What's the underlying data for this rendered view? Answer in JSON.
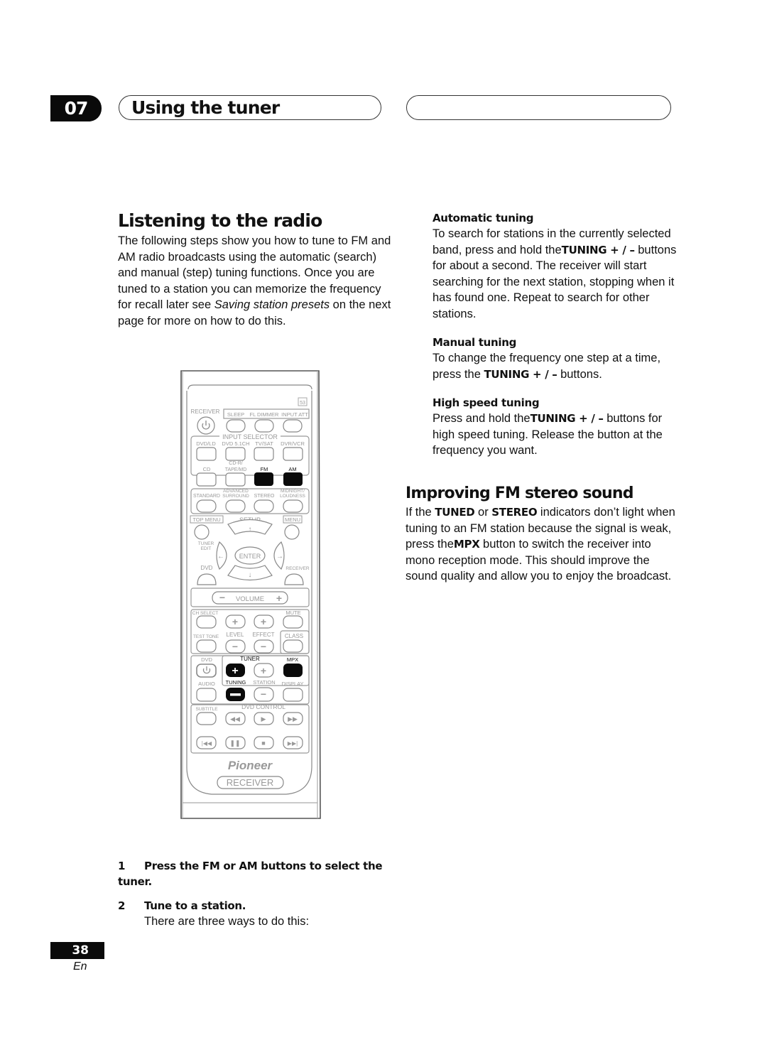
{
  "header": {
    "chapter_number": "07",
    "chapter_title": "Using the tuner"
  },
  "section1": {
    "title": "Listening to the radio",
    "intro_before": "The following steps show you how to tune to FM and AM radio broadcasts using the automatic (search) and manual (step) tuning functions. Once you are tuned to a station you can memorize the frequency for recall later see ",
    "intro_italic": "Saving station presets",
    "intro_after": " on the next page for more on how to do this."
  },
  "remote": {
    "receiver_label": "RECEIVER",
    "top_labels": [
      "SLEEP",
      "FL DIMMER",
      "INPUT ATT"
    ],
    "input_selector_label": "INPUT SELECTOR",
    "input_row1": [
      "DVD/LD",
      "DVD 5.1CH",
      "TV/SAT",
      "DVR/VCR"
    ],
    "input_row2": [
      "CD",
      "CD-R/ TAPE/MD",
      "FM",
      "AM"
    ],
    "mode_row": [
      "STANDARD",
      "ADVANCED SURROUND",
      "STEREO",
      "MIDNIGHT/ LOUDNESS"
    ],
    "top_menu": "TOP MENU",
    "setup": "SETUP",
    "menu": "MENU",
    "tuner_edit": "TUNER EDIT",
    "enter": "ENTER",
    "dvd": "DVD",
    "receiver_small": "RECEIVER",
    "volume": "VOLUME",
    "ch_select": "CH SELECT",
    "mute": "MUTE",
    "test_tone": "TEST TONE",
    "level": "LEVEL",
    "effect": "EFFECT",
    "class": "CLASS",
    "tuner": "TUNER",
    "mpx": "MPX",
    "audio": "AUDIO",
    "tuning": "TUNING",
    "station": "STATION",
    "display": "DISPLAY",
    "subtitle": "SUBTITLE",
    "dvd_control": "DVD CONTROL",
    "brand": "Pioneer",
    "model_label": "RECEIVER",
    "highlighted_buttons": [
      "FM",
      "AM",
      "TUNING +",
      "TUNING -",
      "MPX"
    ]
  },
  "steps": [
    {
      "num": "1",
      "title": "Press the FM or AM buttons to select the tuner.",
      "body": ""
    },
    {
      "num": "2",
      "title": "Tune to a station.",
      "body": "There are three ways to do this:"
    }
  ],
  "automatic": {
    "title": "Automatic tuning",
    "t1": "To search for stations in the currently selected band, press and hold the",
    "b1": "TUNING + / –",
    "t2": " buttons for about a second. The receiver will start searching for the next station, stopping when it has found one. Repeat to search for other stations."
  },
  "manual": {
    "title": "Manual tuning",
    "t1": "To change the frequency one step at a time, press the ",
    "b1": "TUNING + / –",
    "t2": " buttons."
  },
  "high_speed": {
    "title": "High speed tuning",
    "t1": "Press and hold the",
    "b1": "TUNING + / –",
    "t2": " buttons for high speed tuning. Release the button at the frequency you want."
  },
  "section2": {
    "title": "Improving FM stereo sound",
    "t1": "If the ",
    "b1": "TUNED",
    "t2": " or ",
    "b2": "STEREO",
    "t3": " indicators don’t light when tuning to an FM station because the signal is weak, press the",
    "b3": "MPX",
    "t4": " button to switch the receiver into mono reception mode. This should improve the sound quality and allow you to enjoy the broadcast."
  },
  "footer": {
    "page_number": "38",
    "language": "En"
  }
}
